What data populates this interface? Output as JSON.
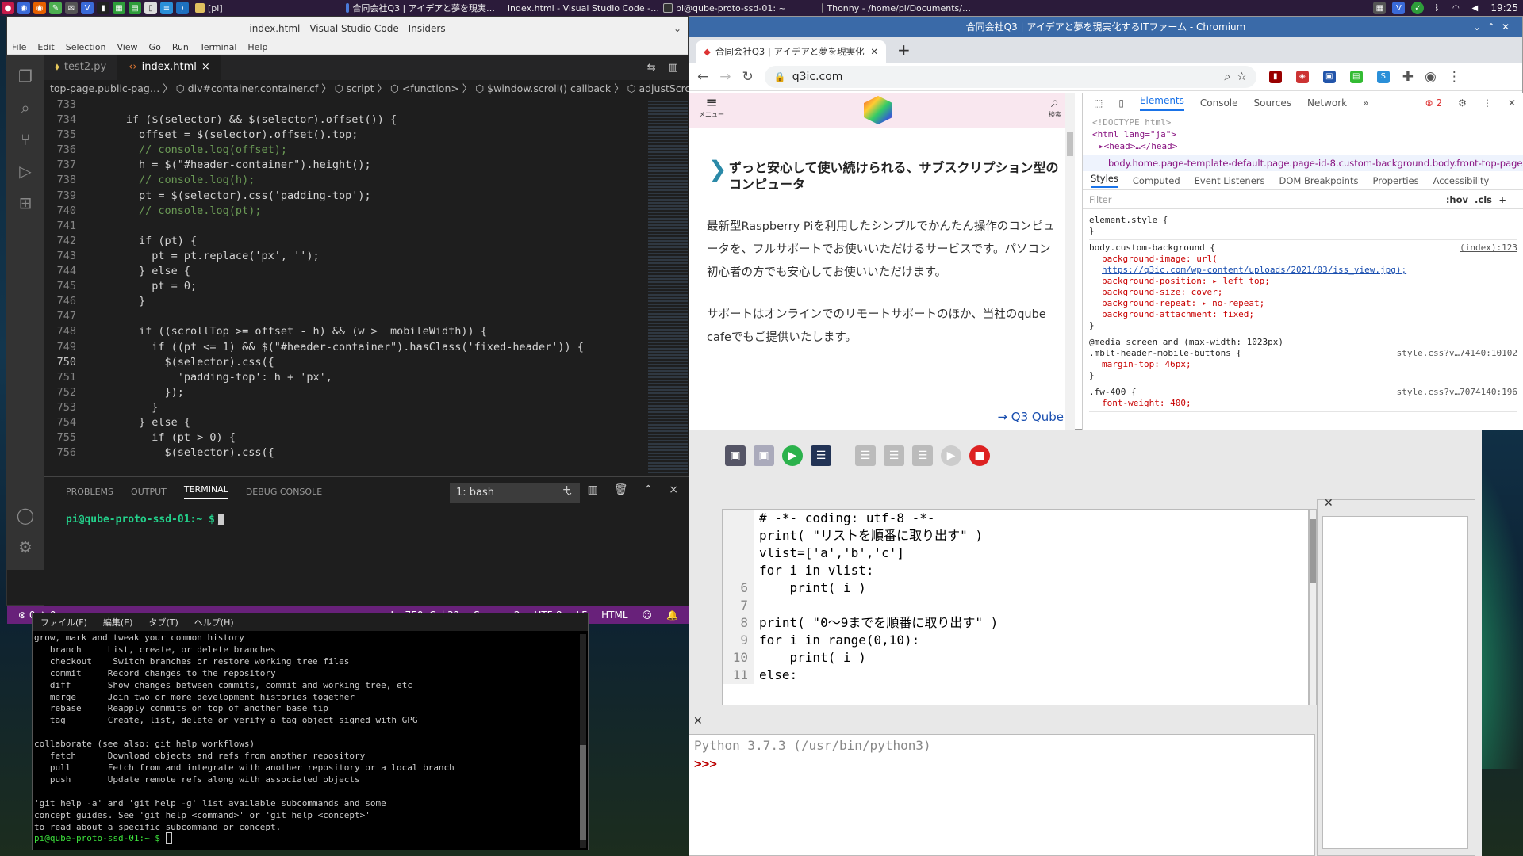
{
  "panel": {
    "tasks": [
      {
        "label": "[pi]",
        "color": "#e0c060"
      },
      {
        "label": "合同会社Q3 | アイデアと夢を現実…",
        "color": "#4a7ad8"
      },
      {
        "label": "index.html - Visual Studio Code -…",
        "color": "#2a8fd8"
      },
      {
        "label": "pi@qube-proto-ssd-01: ~",
        "color": "#333"
      },
      {
        "label": "Thonny  -  /home/pi/Documents/…",
        "color": "#888"
      }
    ],
    "clock": "19:25"
  },
  "vscode": {
    "title": "index.html - Visual Studio Code - Insiders",
    "menu": [
      "File",
      "Edit",
      "Selection",
      "View",
      "Go",
      "Run",
      "Terminal",
      "Help"
    ],
    "tabs": [
      {
        "label": "test2.py",
        "icon": "python-icon"
      },
      {
        "label": "index.html",
        "icon": "html-icon"
      }
    ],
    "breadcrumb": "top-page.public-pag… 〉 ⬡ div#container.container.cf 〉 ⬡ script 〉 ⬡ <function> 〉 ⬡ $window.scroll() callback 〉 ⬡ adjustScroll",
    "lines": [
      {
        "n": "733",
        "t": ""
      },
      {
        "n": "734",
        "t": "      if ($(selector) && $(selector).offset()) {"
      },
      {
        "n": "735",
        "t": "        offset = $(selector).offset().top;"
      },
      {
        "n": "736",
        "t": "        // console.log(offset);"
      },
      {
        "n": "737",
        "t": "        h = $(\"#header-container\").height();"
      },
      {
        "n": "738",
        "t": "        // console.log(h);"
      },
      {
        "n": "739",
        "t": "        pt = $(selector).css('padding-top');"
      },
      {
        "n": "740",
        "t": "        // console.log(pt);"
      },
      {
        "n": "741",
        "t": ""
      },
      {
        "n": "742",
        "t": "        if (pt) {"
      },
      {
        "n": "743",
        "t": "          pt = pt.replace('px', '');"
      },
      {
        "n": "744",
        "t": "        } else {"
      },
      {
        "n": "745",
        "t": "          pt = 0;"
      },
      {
        "n": "746",
        "t": "        }"
      },
      {
        "n": "747",
        "t": ""
      },
      {
        "n": "748",
        "t": "        if ((scrollTop >= offset - h) && (w >  mobileWidth)) {"
      },
      {
        "n": "749",
        "t": "          if ((pt <= 1) && $(\"#header-container\").hasClass('fixed-header')) {"
      },
      {
        "n": "750",
        "t": "            $(selector).css({"
      },
      {
        "n": "751",
        "t": "              'padding-top': h + 'px',"
      },
      {
        "n": "752",
        "t": "            });"
      },
      {
        "n": "753",
        "t": "          }"
      },
      {
        "n": "754",
        "t": "        } else {"
      },
      {
        "n": "755",
        "t": "          if (pt > 0) {"
      },
      {
        "n": "756",
        "t": "            $(selector).css({"
      }
    ],
    "panel_tabs": [
      "PROBLEMS",
      "OUTPUT",
      "TERMINAL",
      "DEBUG CONSOLE"
    ],
    "terminal_select": "1: bash",
    "prompt": "pi@qube-proto-ssd-01:~ $",
    "status": {
      "errors": "⊗ 0 ⚠ 0",
      "position": "Ln 750, Col 32",
      "spaces": "Spaces: 2",
      "encoding": "UTF-8",
      "eol": "LF",
      "lang": "HTML"
    }
  },
  "lxterm": {
    "menu": [
      "ファイル(F)",
      "編集(E)",
      "タブ(T)",
      "ヘルプ(H)"
    ],
    "text": "grow, mark and tweak your common history\n   branch     List, create, or delete branches\n   checkout    Switch branches or restore working tree files\n   commit     Record changes to the repository\n   diff       Show changes between commits, commit and working tree, etc\n   merge      Join two or more development histories together\n   rebase     Reapply commits on top of another base tip\n   tag        Create, list, delete or verify a tag object signed with GPG\n\ncollaborate (see also: git help workflows)\n   fetch      Download objects and refs from another repository\n   pull       Fetch from and integrate with another repository or a local branch\n   push       Update remote refs along with associated objects\n\n'git help -a' and 'git help -g' list available subcommands and some\nconcept guides. See 'git help <command>' or 'git help <concept>'\nto read about a specific subcommand or concept.",
    "prompt": "pi@qube-proto-ssd-01:~ $"
  },
  "chromium": {
    "title": "合同会社Q3 | アイデアと夢を現実化するITファーム - Chromium",
    "tab": "合同会社Q3 | アイデアと夢を現実化",
    "url": "q3ic.com",
    "page": {
      "menu_label": "メニュー",
      "search_label": "検索",
      "heading": "ずっと安心して使い続けられる、サブスクリプション型のコンピュータ",
      "para1": "最新型Raspberry Piを利用したシンプルでかんたん操作のコンピュータを、フルサポートでお使いいただけるサービスです。パソコン初心者の方でも安心してお使いいただけます。",
      "para2": "サポートはオンラインでのリモートサポートのほか、当社のqube cafeでもご提供いたします。",
      "link": "→ Q3 Qube"
    },
    "devtools": {
      "tabs": [
        "Elements",
        "Console",
        "Sources",
        "Network",
        "»"
      ],
      "errors": "2",
      "dom": [
        "<!DOCTYPE html>",
        "<html lang=\"ja\">",
        "▸<head>…</head>"
      ],
      "selected": "body.home.page-template-default.page.page-id-8.custom-background.body.front-top-page.pu",
      "style_tabs": [
        "Styles",
        "Computed",
        "Event Listeners",
        "DOM Breakpoints",
        "Properties",
        "Accessibility"
      ],
      "filter": "Filter",
      "hov": ":hov",
      "cls": ".cls",
      "element_style": "element.style {",
      "r1_sel": "body.custom-background {",
      "r1_src": "(index):123",
      "r1_props": [
        "background-image: url(",
        "    https://q3ic.com/wp-content/uploads/2021/03/iss_view.jpg);",
        "background-position: ▸ left top;",
        "background-size: cover;",
        "background-repeat: ▸ no-repeat;",
        "background-attachment: fixed;"
      ],
      "r2_media": "@media screen and (max-width: 1023px)",
      "r2_sel": ".mblt-header-mobile-buttons {",
      "r2_src": "style.css?v…74140:10102",
      "r2_prop": "margin-top: 46px;",
      "r3_sel": ".fw-400 {",
      "r3_src": "style.css?v…7074140:196",
      "r3_prop": "font-weight: 400;"
    }
  },
  "thonny": {
    "code_lines": [
      {
        "n": "",
        "t": "# -*- coding: utf-8 -*-",
        "c": "cm"
      },
      {
        "n": "",
        "t": "",
        "c": ""
      },
      {
        "n": "",
        "t": "print( \"リストを順番に取り出す\" )",
        "c": ""
      },
      {
        "n": "",
        "t": "vlist=['a','b','c']",
        "c": ""
      },
      {
        "n": "",
        "t": "for i in vlist:",
        "c": ""
      },
      {
        "n": "6",
        "t": "    print( i )",
        "c": ""
      },
      {
        "n": "7",
        "t": "",
        "c": ""
      },
      {
        "n": "8",
        "t": "print( \"0〜9までを順番に取り出す\" )",
        "c": ""
      },
      {
        "n": "9",
        "t": "for i in range(0,10):",
        "c": ""
      },
      {
        "n": "10",
        "t": "    print( i )",
        "c": ""
      },
      {
        "n": "11",
        "t": "else:",
        "c": ""
      }
    ],
    "shell_version": "Python 3.7.3 (/usr/bin/python3)",
    "shell_prompt": ">>>"
  }
}
